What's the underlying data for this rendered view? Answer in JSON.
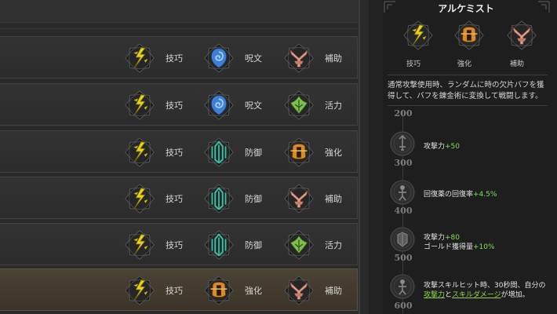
{
  "trait_names": {
    "skill": "技巧",
    "spell": "呪文",
    "assist": "補助",
    "vitality": "活力",
    "defense": "防御",
    "enhance": "強化"
  },
  "rows": [
    {
      "traits": [
        {
          "icon": "skill-emblem-icon",
          "label": "技巧"
        },
        {
          "icon": "spell-emblem-icon",
          "label": "呪文"
        },
        {
          "icon": "assist-emblem-icon",
          "label": "補助"
        }
      ],
      "selected": false
    },
    {
      "traits": [
        {
          "icon": "skill-emblem-icon",
          "label": "技巧"
        },
        {
          "icon": "spell-emblem-icon",
          "label": "呪文"
        },
        {
          "icon": "vitality-emblem-icon",
          "label": "活力"
        }
      ],
      "selected": false
    },
    {
      "traits": [
        {
          "icon": "skill-emblem-icon",
          "label": "技巧"
        },
        {
          "icon": "defense-emblem-icon",
          "label": "防御"
        },
        {
          "icon": "enhance-emblem-icon",
          "label": "強化"
        }
      ],
      "selected": false
    },
    {
      "traits": [
        {
          "icon": "skill-emblem-icon",
          "label": "技巧"
        },
        {
          "icon": "defense-emblem-icon",
          "label": "防御"
        },
        {
          "icon": "assist-emblem-icon",
          "label": "補助"
        }
      ],
      "selected": false
    },
    {
      "traits": [
        {
          "icon": "skill-emblem-icon",
          "label": "技巧"
        },
        {
          "icon": "defense-emblem-icon",
          "label": "防御"
        },
        {
          "icon": "vitality-emblem-icon",
          "label": "活力"
        }
      ],
      "selected": false
    },
    {
      "traits": [
        {
          "icon": "skill-emblem-icon",
          "label": "技巧"
        },
        {
          "icon": "enhance-emblem-icon",
          "label": "強化"
        },
        {
          "icon": "assist-emblem-icon",
          "label": "補助"
        }
      ],
      "selected": true
    }
  ],
  "detail": {
    "title": "アルケミスト",
    "traits": [
      {
        "icon": "skill-emblem-icon",
        "label": "技巧"
      },
      {
        "icon": "enhance-emblem-icon",
        "label": "強化"
      },
      {
        "icon": "assist-emblem-icon",
        "label": "補助"
      }
    ],
    "description": "通常攻撃使用時、ランダムに時の欠片バフを獲得して、バフを錬金術に変換して戦闘します。",
    "first_level_cut": "200",
    "milestones": [
      {
        "level": "300",
        "icon": "sword-medal-icon",
        "line1": "攻撃力",
        "value1": "+50"
      },
      {
        "level": "400",
        "icon": "figure-medal-icon",
        "line1": "回復薬の回復率",
        "value1": "+4.5%"
      },
      {
        "level": "500",
        "icon": "armor-medal-icon",
        "line1": "攻撃力",
        "value1": "+80",
        "line2": "ゴールド獲得量",
        "value2": "+10%"
      },
      {
        "level": "600",
        "icon": "figure-medal-icon",
        "text_a": "攻撃スキルヒット時、30秒間、自分の",
        "link1": "攻撃力",
        "text_b": "と",
        "link2": "スキルダメージ",
        "text_c": "が増加。"
      }
    ]
  },
  "colors": {
    "skill": "#e9d21e",
    "spell": "#3d7fd4",
    "assist": "#e2a08e",
    "vitality": "#7fbf4d",
    "defense": "#39c4a8",
    "enhance": "#d98a2a",
    "bonus_green": "#7ee05a",
    "selected_row": "#4a4233"
  }
}
